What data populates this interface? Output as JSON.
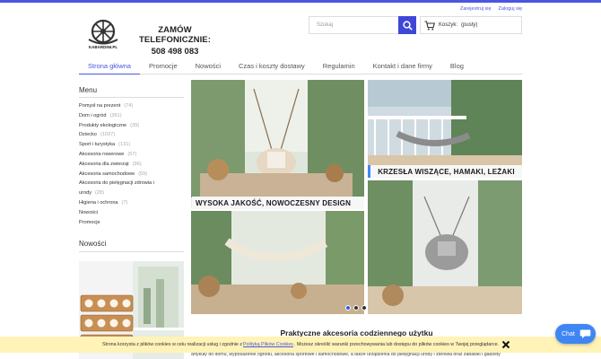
{
  "account": {
    "register": "Zarejestruj się",
    "login": "Zaloguj się"
  },
  "logo": {
    "text": "KABARDINI.PL"
  },
  "phone": {
    "line1": "ZAMÓW TELEFONICZNIE:",
    "line2": "508 498 083"
  },
  "search": {
    "placeholder": "Szukaj"
  },
  "cart": {
    "label": "Koszyk:",
    "status": "(pusty)"
  },
  "nav": [
    {
      "label": "Strona główna",
      "active": true
    },
    {
      "label": "Promocje"
    },
    {
      "label": "Nowości"
    },
    {
      "label": "Czas i koszty dostawy"
    },
    {
      "label": "Regulamin"
    },
    {
      "label": "Kontakt i dane firmy"
    },
    {
      "label": "Blog"
    }
  ],
  "sidebar": {
    "menu_title": "Menu",
    "items": [
      {
        "label": "Pomysł na prezent",
        "count": "(74)"
      },
      {
        "label": "Dom i ogród",
        "count": "(361)"
      },
      {
        "label": "Produkty ekologiczne",
        "count": "(39)"
      },
      {
        "label": "Dziecko",
        "count": "(1037)"
      },
      {
        "label": "Sport i turystyka",
        "count": "(131)"
      },
      {
        "label": "Akcesoria rowerowe",
        "count": "(67)"
      },
      {
        "label": "Akcesoria dla zwierząt",
        "count": "(96)"
      },
      {
        "label": "Akcesoria samochodowe",
        "count": "(59)"
      },
      {
        "label": "Akcesoria do pielęgnacji zdrowia i urody",
        "count": "(28)"
      },
      {
        "label": "Higiena i ochrona",
        "count": "(7)"
      },
      {
        "label": "Nowości",
        "count": ""
      },
      {
        "label": "Promocje",
        "count": ""
      }
    ],
    "new_title": "Nowości"
  },
  "slider": {
    "label_left": "WYSOKA JAKOŚĆ, NOWOCZESNY DESIGN",
    "label_right": "KRZESŁA WISZĄCE, HAMAKI, LEŻAKI",
    "active_slide": 1,
    "slide_count": 3
  },
  "content": {
    "title": "Praktyczne akcesoria codziennego użytku",
    "body": "artykuły do domu, wyposażenie ogrodu, akcesoria sportowe i samochodowe, a także urządzenia do pielęgnacji urody i zdrowia oraz zabawki i gadżety"
  },
  "cookie": {
    "text_before": "Strona korzysta z plików cookies w celu realizacji usług i zgodnie z",
    "link": "Polityką Plików Cookies",
    "text_after": ". Możesz określić warunki przechowywania lub dostępu do plików cookies w Twojej przeglądarce."
  },
  "chat": {
    "label": "Chat"
  },
  "colors": {
    "accent": "#4b56e0",
    "cookie_bg": "#fff3b8",
    "chat_bg": "#3f86f5"
  },
  "icons": [
    "logo-wheel-icon",
    "search-icon",
    "cart-icon",
    "close-icon",
    "chat-bubble-icon"
  ]
}
